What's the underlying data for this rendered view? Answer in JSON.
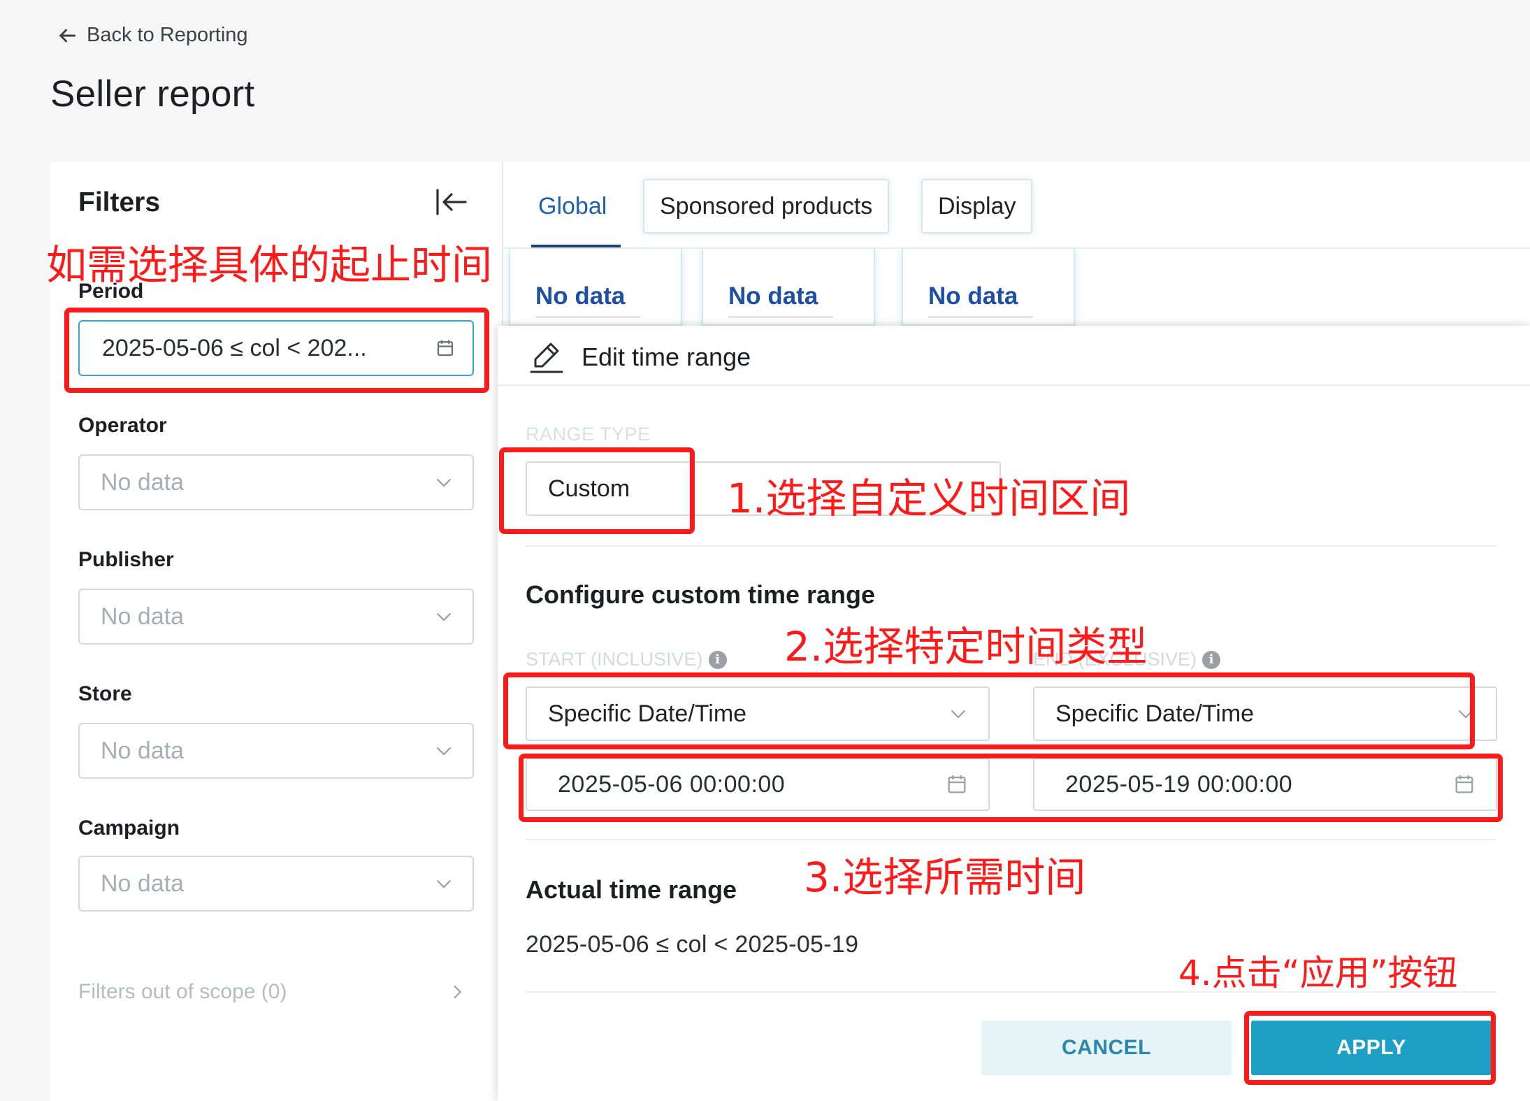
{
  "header": {
    "back_label": "Back to Reporting",
    "page_title": "Seller report"
  },
  "filters": {
    "title": "Filters",
    "period": {
      "label": "Period",
      "value": "2025-05-06 ≤ col < 202..."
    },
    "operator": {
      "label": "Operator",
      "value": "No data"
    },
    "publisher": {
      "label": "Publisher",
      "value": "No data"
    },
    "store": {
      "label": "Store",
      "value": "No data"
    },
    "campaign": {
      "label": "Campaign",
      "value": "No data"
    },
    "out_of_scope": "Filters out of scope (0)"
  },
  "tabs": [
    {
      "label": "Global",
      "active": true
    },
    {
      "label": "Sponsored products",
      "active": false
    },
    {
      "label": "Display",
      "active": false
    }
  ],
  "cards": [
    "No data",
    "No data",
    "No data"
  ],
  "modal": {
    "title": "Edit time range",
    "range_type_label": "RANGE TYPE",
    "range_type_value": "Custom",
    "configure_title": "Configure custom time range",
    "start_label": "START (INCLUSIVE)",
    "end_label": "END (EXCLUSIVE)",
    "start_type": "Specific Date/Time",
    "end_type": "Specific Date/Time",
    "start_datetime": "2025-05-06 00:00:00",
    "end_datetime": "2025-05-19 00:00:00",
    "actual_title": "Actual time range",
    "actual_value": "2025-05-06 ≤ col < 2025-05-19",
    "cancel_label": "CANCEL",
    "apply_label": "APPLY"
  },
  "annotations": {
    "intro": "如需选择具体的起止时间",
    "step1": "1.选择自定义时间区间",
    "step2": "2.选择特定时间类型",
    "step3": "3.选择所需时间",
    "step4": "4.点击“应用”按钮"
  },
  "colors": {
    "accent": "#1ea0c6",
    "annotation": "#ff1a1a",
    "tab_active": "#1f5fae",
    "card_value": "#1d4fa3"
  }
}
